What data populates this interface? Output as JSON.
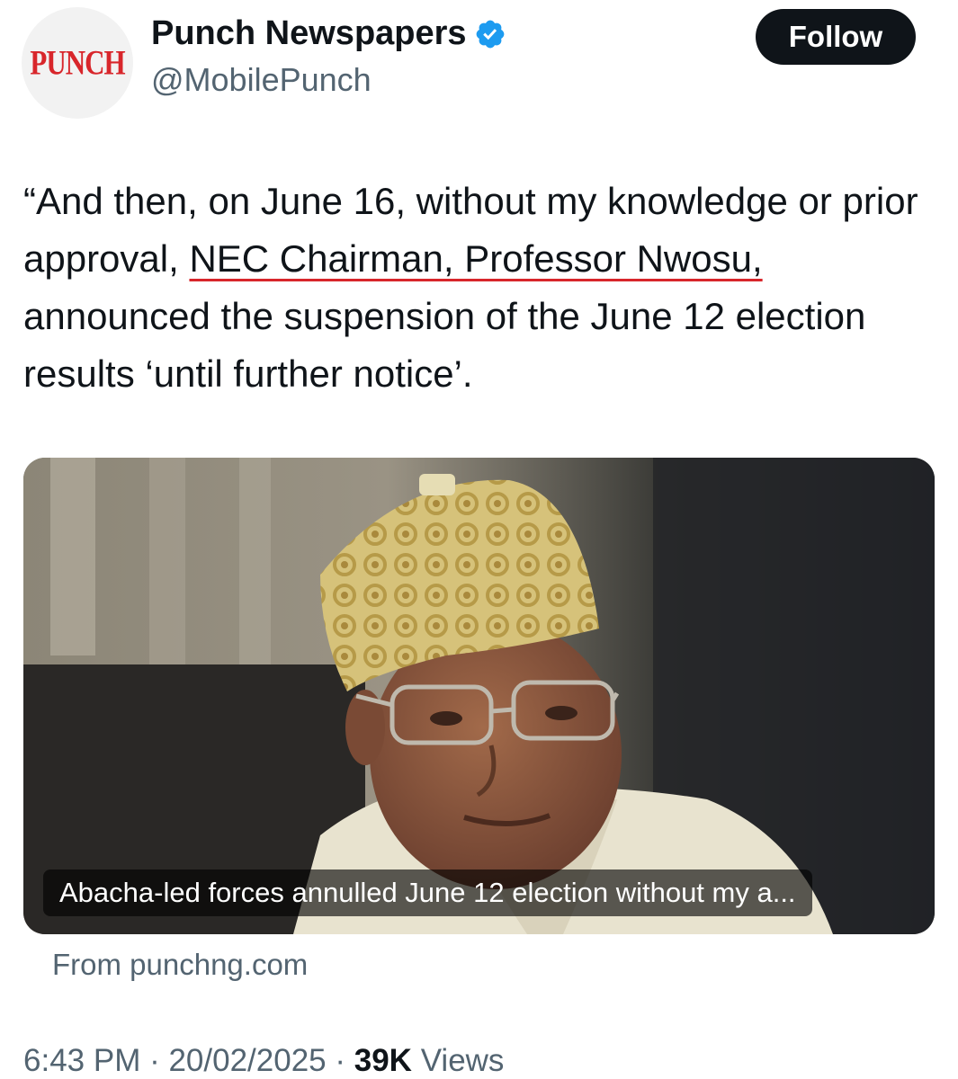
{
  "author": {
    "avatar_text": "PUNCH",
    "display_name": "Punch Newspapers",
    "handle": "@MobilePunch",
    "verified": true,
    "verified_icon": "verified-badge-icon"
  },
  "follow_label": "Follow",
  "tweet": {
    "text_before": "“And then, on June 16, without my knowledge or prior approval, ",
    "text_highlight": "NEC Chairman, Professor Nwosu,",
    "text_after": " announced the suspension of the June 12 election results ‘until further notice’."
  },
  "card": {
    "caption": "Abacha-led forces annulled June 12 election without my a...",
    "source": "From punchng.com"
  },
  "meta": {
    "time": "6:43 PM",
    "date": "20/02/2025",
    "separator": " · ",
    "views_count": "39K",
    "views_label": "Views"
  },
  "colors": {
    "brand_red": "#d8262b",
    "verified_blue": "#1d9bf0",
    "text": "#0f1419",
    "muted": "#536471"
  }
}
